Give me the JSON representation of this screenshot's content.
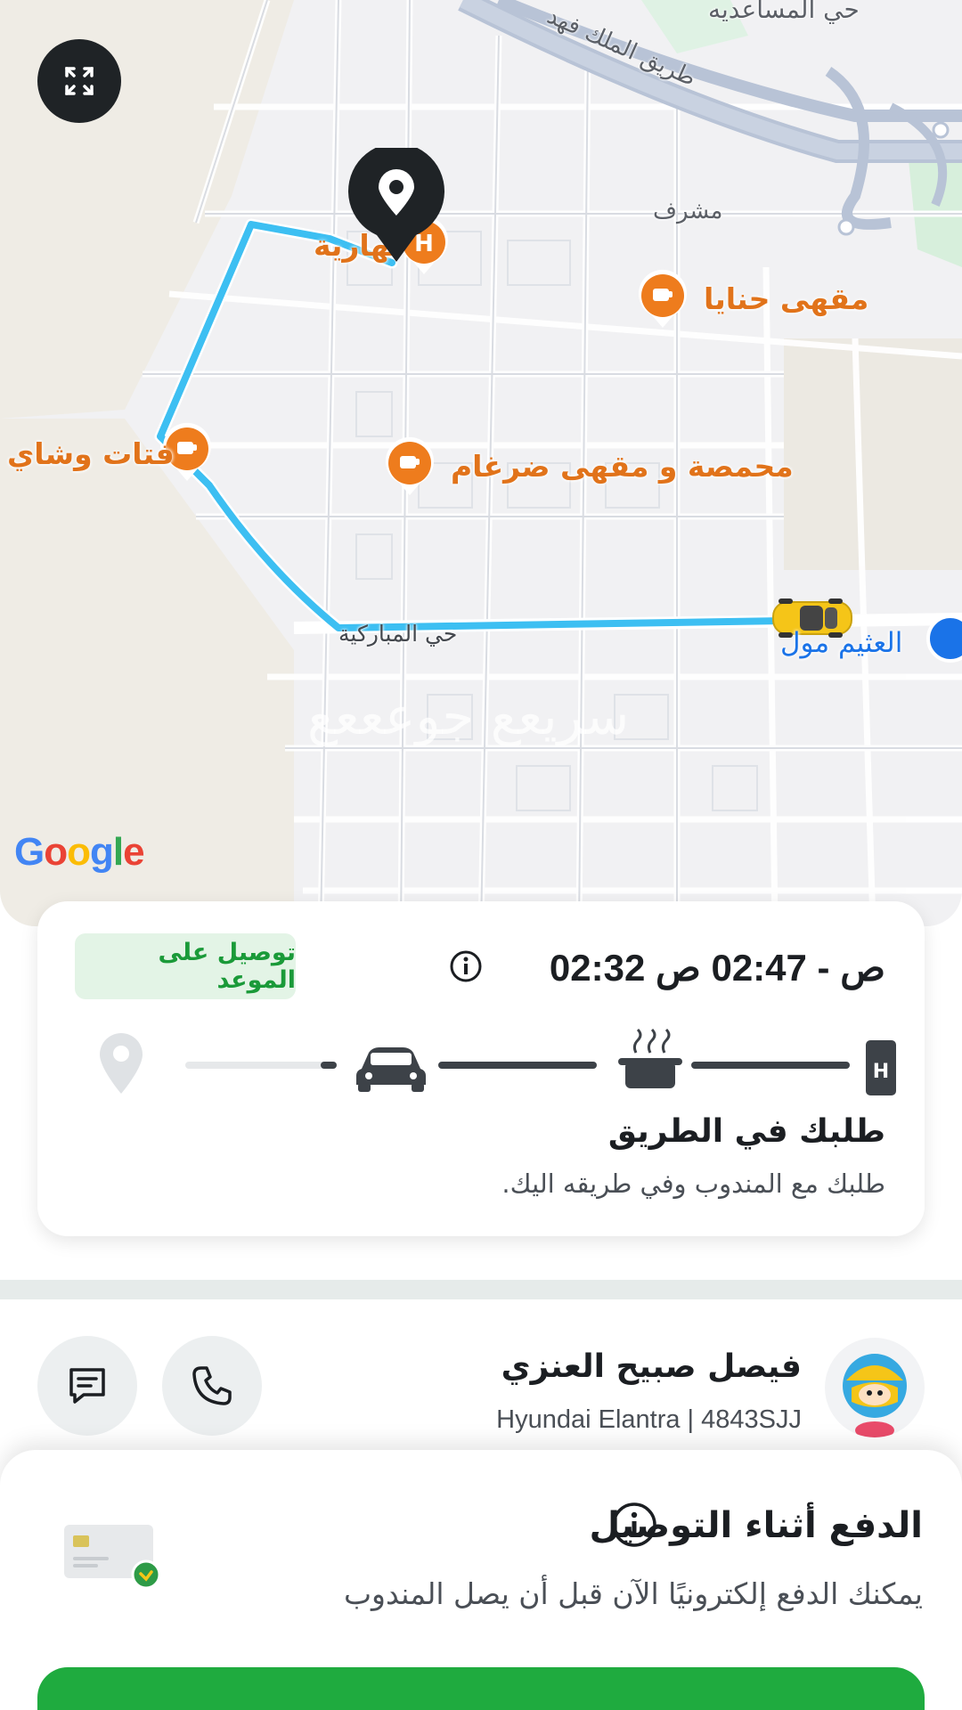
{
  "map": {
    "labels": {
      "king_fahd_road": "طريق الملك فهد",
      "al_masaeed": "حي المساعديه",
      "mushrif": "مشرف",
      "poi_partial": "نهارية",
      "hanaya_cafe": "مقهى حنايا",
      "fatat_tea": "فتات وشاي",
      "roastery": "محمصة و مقهى ضرغام",
      "mubarakiya": "حي المباركية",
      "othaim_mall": "العثيم مول",
      "watermark": "سريعع جوعععع"
    },
    "google_logo": "Google",
    "expand_icon": "expand-icon",
    "route_color": "#3dbff2",
    "poi_color": "#e1731a"
  },
  "order": {
    "eta": "02:32 ص - 02:47 ص",
    "badge": "توصيل على الموعد",
    "status_title": "طلبك في الطريق",
    "status_subtitle": "طلبك مع المندوب وفي طريقه اليك.",
    "progress_fraction": 0.85,
    "steps": [
      "restaurant-icon",
      "cooking-icon",
      "car-icon",
      "location-pin-icon"
    ]
  },
  "driver": {
    "name": "فيصل صبيح العنزي",
    "vehicle": "Hyundai Elantra | 4843SJJ"
  },
  "payment": {
    "title": "الدفع أثناء التوصيل",
    "subtitle": "يمكنك الدفع إلكترونيًا الآن قبل أن يصل المندوب",
    "accent": "#1fab3f"
  }
}
